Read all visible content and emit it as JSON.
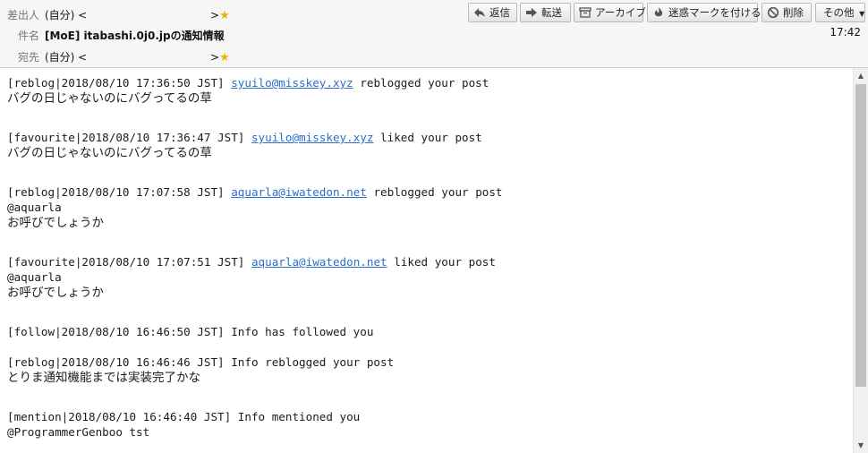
{
  "header": {
    "from_label": "差出人",
    "from_value": "(自分) <",
    "from_suffix": ">",
    "subject_label": "件名",
    "subject_value": "[MoE] itabashi.0j0.jpの通知情報",
    "to_label": "宛先",
    "to_value": "(自分) <",
    "to_suffix": ">",
    "time": "17:42"
  },
  "toolbar": {
    "reply": "返信",
    "forward": "転送",
    "archive": "アーカイブ",
    "junk": "迷惑マークを付ける",
    "delete": "削除",
    "more": "その他"
  },
  "icons": {
    "reply": "reply-arrow-icon",
    "forward": "forward-arrow-icon",
    "archive": "archive-box-icon",
    "junk": "junk-flame-icon",
    "delete": "delete-circle-icon",
    "star": "star-icon",
    "more": "chevron-down-icon"
  },
  "colors": {
    "link": "#2a6fc9",
    "star": "#e8b400"
  },
  "entries": [
    {
      "prefix": "[reblog|2018/08/10 17:36:50 JST] ",
      "link": "syuilo@misskey.xyz",
      "suffix": " reblogged your post",
      "body": [
        "バグの日じゃないのにバグってるの草"
      ]
    },
    {
      "prefix": "[favourite|2018/08/10 17:36:47 JST] ",
      "link": "syuilo@misskey.xyz",
      "suffix": " liked your post",
      "body": [
        "バグの日じゃないのにバグってるの草"
      ]
    },
    {
      "prefix": "[reblog|2018/08/10 17:07:58 JST] ",
      "link": "aquarla@iwatedon.net",
      "suffix": " reblogged your post",
      "body": [
        "@aquarla",
        "お呼びでしょうか"
      ]
    },
    {
      "prefix": "[favourite|2018/08/10 17:07:51 JST] ",
      "link": "aquarla@iwatedon.net",
      "suffix": " liked your post",
      "body": [
        "@aquarla",
        "お呼びでしょうか"
      ]
    },
    {
      "prefix": "[follow|2018/08/10 16:46:50 JST] Info has followed you",
      "link": "",
      "suffix": "",
      "body": []
    },
    {
      "prefix": "[reblog|2018/08/10 16:46:46 JST] Info reblogged your post",
      "link": "",
      "suffix": "",
      "body": [
        "とりま通知機能までは実装完了かな"
      ]
    },
    {
      "prefix": "[mention|2018/08/10 16:46:40 JST] Info mentioned you",
      "link": "",
      "suffix": "",
      "body": [
        "@ProgrammerGenboo tst"
      ]
    }
  ]
}
